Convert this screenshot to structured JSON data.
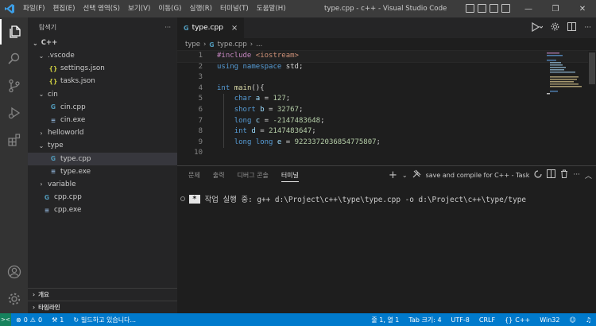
{
  "window": {
    "title": "type.cpp - c++ - Visual Studio Code",
    "menu": [
      "파일(F)",
      "편집(E)",
      "선택 영역(S)",
      "보기(V)",
      "이동(G)",
      "실행(R)",
      "터미널(T)",
      "도움말(H)"
    ],
    "controls": {
      "minimize": "—",
      "restore": "❐",
      "close": "✕"
    }
  },
  "activity_bar": {
    "icons": [
      "explorer-icon",
      "search-icon",
      "source-control-icon",
      "run-debug-icon",
      "extensions-icon",
      "account-icon",
      "manage-gear-icon"
    ]
  },
  "sidebar": {
    "header": "탐색기",
    "more": "···",
    "root": "C++",
    "tree": [
      {
        "label": ".vscode",
        "type": "folder",
        "open": true,
        "depth": 1
      },
      {
        "label": "settings.json",
        "type": "json",
        "depth": 2
      },
      {
        "label": "tasks.json",
        "type": "json",
        "depth": 2
      },
      {
        "label": "cin",
        "type": "folder",
        "open": true,
        "depth": 1
      },
      {
        "label": "cin.cpp",
        "type": "cpp",
        "depth": 2
      },
      {
        "label": "cin.exe",
        "type": "exe",
        "depth": 2
      },
      {
        "label": "helloworld",
        "type": "folder",
        "open": false,
        "depth": 1
      },
      {
        "label": "type",
        "type": "folder",
        "open": true,
        "depth": 1
      },
      {
        "label": "type.cpp",
        "type": "cpp",
        "depth": 2,
        "selected": true
      },
      {
        "label": "type.exe",
        "type": "exe",
        "depth": 2
      },
      {
        "label": "variable",
        "type": "folder",
        "open": false,
        "depth": 1
      },
      {
        "label": "cpp.cpp",
        "type": "cpp",
        "depth": 1
      },
      {
        "label": "cpp.exe",
        "type": "exe",
        "depth": 1
      }
    ],
    "outline": "개요",
    "timeline": "타임라인"
  },
  "editor": {
    "tab": {
      "label": "type.cpp",
      "close": "×"
    },
    "breadcrumb": [
      "type",
      "type.cpp",
      "..."
    ],
    "lines": [
      {
        "n": "1",
        "text": "#include <iostream>"
      },
      {
        "n": "2",
        "text": "using namespace std;"
      },
      {
        "n": "3",
        "text": ""
      },
      {
        "n": "4",
        "text": "int main(){"
      },
      {
        "n": "5",
        "text": "    char a = 127;"
      },
      {
        "n": "6",
        "text": "    short b = 32767;"
      },
      {
        "n": "7",
        "text": "    long c = -2147483648;"
      },
      {
        "n": "8",
        "text": "    int d = 2147483647;"
      },
      {
        "n": "9",
        "text": "    long long e = 9223372036854775807;"
      },
      {
        "n": "10",
        "text": ""
      }
    ]
  },
  "panel": {
    "tabs": [
      "문제",
      "출력",
      "디버그 콘솔",
      "터미널"
    ],
    "active_tab": "터미널",
    "task": "save and compile for C++ - Task",
    "terminal_marker": "*",
    "terminal_line": "작업 실행 중: g++ d:\\Project\\c++\\type\\type.cpp -o d:\\Project\\c++\\type/type"
  },
  "status_bar": {
    "errors": "0",
    "warnings": "0",
    "ports": "1",
    "building": "빌드하고 있습니다...",
    "position": "줄 1, 열 1",
    "tab_size": "Tab 크기: 4",
    "encoding": "UTF-8",
    "eol": "CRLF",
    "language": "C++",
    "platform": "Win32"
  },
  "colors": {
    "accent": "#007acc",
    "titlebar": "#3c3c3c",
    "sidebar": "#252526",
    "editor": "#1e1e1e",
    "keyword": "#569cd6",
    "number": "#b5cea8",
    "string": "#ce9178"
  }
}
